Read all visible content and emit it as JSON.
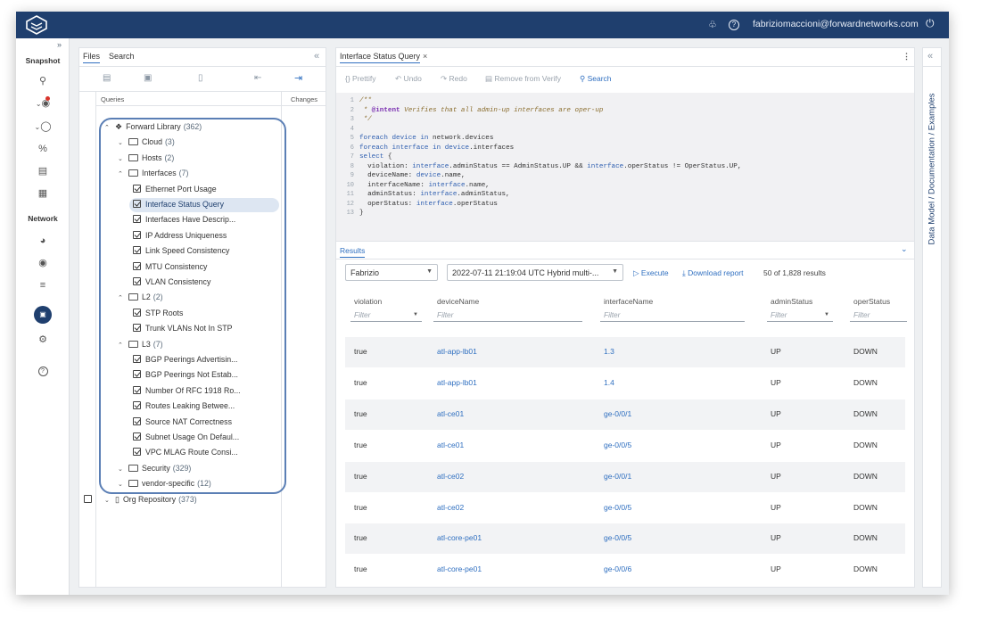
{
  "topbar": {
    "user": "fabriziomaccioni@forwardnetworks.com"
  },
  "leftnav": {
    "snapshot_label": "Snapshot",
    "network_label": "Network"
  },
  "files": {
    "tab_files": "Files",
    "tab_search": "Search",
    "col_queries": "Queries",
    "col_changes": "Changes",
    "tree": [
      {
        "type": "root",
        "label": "Forward Library",
        "count": "(362)"
      },
      {
        "type": "folder",
        "label": "Cloud",
        "count": "(3)"
      },
      {
        "type": "folder",
        "label": "Hosts",
        "count": "(2)"
      },
      {
        "type": "folder-open",
        "label": "Interfaces",
        "count": "(7)"
      },
      {
        "type": "query",
        "label": "Ethernet Port Usage"
      },
      {
        "type": "query",
        "label": "Interface Status Query"
      },
      {
        "type": "query",
        "label": "Interfaces Have Descrip..."
      },
      {
        "type": "query",
        "label": "IP Address Uniqueness"
      },
      {
        "type": "query",
        "label": "Link Speed Consistency"
      },
      {
        "type": "query",
        "label": "MTU Consistency"
      },
      {
        "type": "query",
        "label": "VLAN Consistency"
      },
      {
        "type": "folder-open",
        "label": "L2",
        "count": "(2)"
      },
      {
        "type": "query",
        "label": "STP Roots"
      },
      {
        "type": "query",
        "label": "Trunk VLANs Not In STP"
      },
      {
        "type": "folder-open",
        "label": "L3",
        "count": "(7)"
      },
      {
        "type": "query",
        "label": "BGP Peerings Advertisin..."
      },
      {
        "type": "query",
        "label": "BGP Peerings Not Estab..."
      },
      {
        "type": "query",
        "label": "Number Of RFC 1918 Ro..."
      },
      {
        "type": "query",
        "label": "Routes Leaking Betwee..."
      },
      {
        "type": "query",
        "label": "Source NAT Correctness"
      },
      {
        "type": "query",
        "label": "Subnet Usage On Defaul..."
      },
      {
        "type": "query",
        "label": "VPC MLAG Route Consi..."
      },
      {
        "type": "folder",
        "label": "Security",
        "count": "(329)"
      },
      {
        "type": "folder",
        "label": "vendor-specific",
        "count": "(12)"
      },
      {
        "type": "repo",
        "label": "Org Repository",
        "count": "(373)"
      }
    ]
  },
  "editor": {
    "tab_title": "Interface Status Query",
    "toolbar": {
      "prettify": "Prettify",
      "undo": "Undo",
      "redo": "Redo",
      "remove": "Remove from Verify",
      "search": "Search"
    },
    "code_lines": [
      "/**",
      " * @intent Verifies that all admin-up interfaces are oper-up",
      " */",
      "",
      "foreach device in network.devices",
      "foreach interface in device.interfaces",
      "select {",
      "  violation: interface.adminStatus == AdminStatus.UP && interface.operStatus != OperStatus.UP,",
      "  deviceName: device.name,",
      "  interfaceName: interface.name,",
      "  adminStatus: interface.adminStatus,",
      "  operStatus: interface.operStatus",
      "}"
    ]
  },
  "results": {
    "title": "Results",
    "network_select": "Fabrizio",
    "snapshot_select": "2022-07-11 21:19:04 UTC Hybrid multi-...",
    "execute": "Execute",
    "download": "Download report",
    "count": "50 of 1,828 results",
    "columns": [
      "violation",
      "deviceName",
      "interfaceName",
      "adminStatus",
      "operStatus"
    ],
    "filter_placeholder": "Filter",
    "rows": [
      [
        "true",
        "atl-app-lb01",
        "1.3",
        "UP",
        "DOWN"
      ],
      [
        "true",
        "atl-app-lb01",
        "1.4",
        "UP",
        "DOWN"
      ],
      [
        "true",
        "atl-ce01",
        "ge-0/0/1",
        "UP",
        "DOWN"
      ],
      [
        "true",
        "atl-ce01",
        "ge-0/0/5",
        "UP",
        "DOWN"
      ],
      [
        "true",
        "atl-ce02",
        "ge-0/0/1",
        "UP",
        "DOWN"
      ],
      [
        "true",
        "atl-ce02",
        "ge-0/0/5",
        "UP",
        "DOWN"
      ],
      [
        "true",
        "atl-core-pe01",
        "ge-0/0/5",
        "UP",
        "DOWN"
      ],
      [
        "true",
        "atl-core-pe01",
        "ge-0/0/6",
        "UP",
        "DOWN"
      ]
    ]
  },
  "rightpanel": {
    "label": "Data Model / Documentation / Examples"
  }
}
